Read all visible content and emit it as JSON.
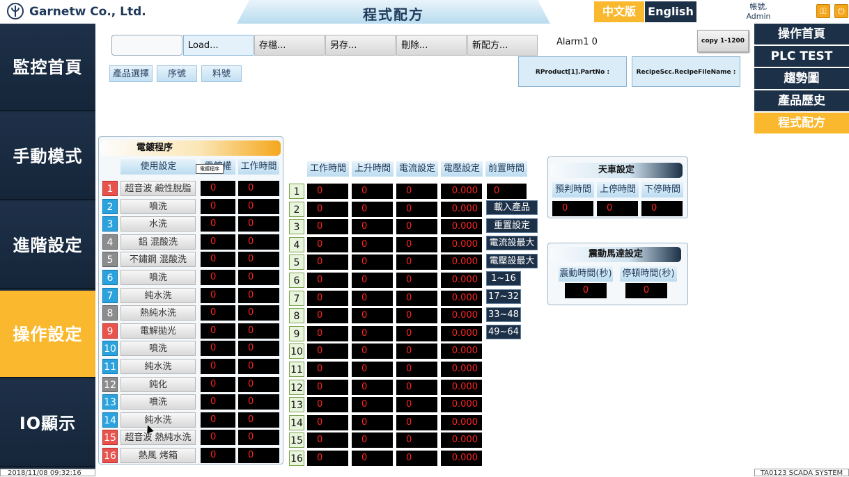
{
  "header": {
    "company": "Garnetw Co., Ltd.",
    "title": "程式配方",
    "lang_zh": "中文版",
    "lang_en": "English",
    "account_label": "帳號,",
    "account_user": "Admin"
  },
  "left_nav": [
    "監控首頁",
    "手動模式",
    "進階設定",
    "操作設定",
    "IO顯示"
  ],
  "right_nav": [
    "操作首頁",
    "PLC TEST",
    "趨勢圖",
    "產品歷史",
    "程式配方"
  ],
  "toolbar": {
    "recipe_input_value": "",
    "load": "Load...",
    "save": "存檔...",
    "save_as": "另存...",
    "delete": "刪除...",
    "new_recipe": "新配方...",
    "alarm": "Alarm1 0",
    "copy": "copy 1-1200"
  },
  "selectors": [
    "產品選擇",
    "序號",
    "料號"
  ],
  "info_boxes": {
    "part_no": "RProduct[1].PartNo :",
    "recipe_file": "RecipeScc.RecipeFileName :"
  },
  "process_panel": {
    "title": "電鍍程序",
    "col_use": "使用設定",
    "col_auth": "電鍍權",
    "col_work": "工作時間",
    "tooltip": "電鍍程序",
    "rows": [
      {
        "n": "1",
        "name": "超音波 鹼性脫脂",
        "a": "0",
        "b": "0"
      },
      {
        "n": "2",
        "name": "噴洗",
        "a": "0",
        "b": "0"
      },
      {
        "n": "3",
        "name": "水洗",
        "a": "0",
        "b": "0"
      },
      {
        "n": "4",
        "name": "鋁 混酸洗",
        "a": "0",
        "b": "0"
      },
      {
        "n": "5",
        "name": "不鏽鋼 混酸洗",
        "a": "0",
        "b": "0"
      },
      {
        "n": "6",
        "name": "噴洗",
        "a": "0",
        "b": "0"
      },
      {
        "n": "7",
        "name": "純水洗",
        "a": "0",
        "b": "0"
      },
      {
        "n": "8",
        "name": "熱純水洗",
        "a": "0",
        "b": "0"
      },
      {
        "n": "9",
        "name": "電解拋光",
        "a": "0",
        "b": "0"
      },
      {
        "n": "10",
        "name": "噴洗",
        "a": "0",
        "b": "0"
      },
      {
        "n": "11",
        "name": "純水洗",
        "a": "0",
        "b": "0"
      },
      {
        "n": "12",
        "name": "鈍化",
        "a": "0",
        "b": "0"
      },
      {
        "n": "13",
        "name": "噴洗",
        "a": "0",
        "b": "0"
      },
      {
        "n": "14",
        "name": "純水洗",
        "a": "0",
        "b": "0"
      },
      {
        "n": "15",
        "name": "超音波 熱純水洗",
        "a": "0",
        "b": "0"
      },
      {
        "n": "16",
        "name": "熱風 烤箱",
        "a": "0",
        "b": "0"
      }
    ]
  },
  "settings_table": {
    "headers": [
      "工作時間",
      "上升時間",
      "電流設定",
      "電壓設定",
      "前置時間"
    ],
    "rows": [
      {
        "n": "1",
        "v": [
          "0",
          "0",
          "0",
          "0.000"
        ]
      },
      {
        "n": "2",
        "v": [
          "0",
          "0",
          "0",
          "0.000"
        ]
      },
      {
        "n": "3",
        "v": [
          "0",
          "0",
          "0",
          "0.000"
        ]
      },
      {
        "n": "4",
        "v": [
          "0",
          "0",
          "0",
          "0.000"
        ]
      },
      {
        "n": "5",
        "v": [
          "0",
          "0",
          "0",
          "0.000"
        ]
      },
      {
        "n": "6",
        "v": [
          "0",
          "0",
          "0",
          "0.000"
        ]
      },
      {
        "n": "7",
        "v": [
          "0",
          "0",
          "0",
          "0.000"
        ]
      },
      {
        "n": "8",
        "v": [
          "0",
          "0",
          "0",
          "0.000"
        ]
      },
      {
        "n": "9",
        "v": [
          "0",
          "0",
          "0",
          "0.000"
        ]
      },
      {
        "n": "10",
        "v": [
          "0",
          "0",
          "0",
          "0.000"
        ]
      },
      {
        "n": "11",
        "v": [
          "0",
          "0",
          "0",
          "0.000"
        ]
      },
      {
        "n": "12",
        "v": [
          "0",
          "0",
          "0",
          "0.000"
        ]
      },
      {
        "n": "13",
        "v": [
          "0",
          "0",
          "0",
          "0.000"
        ]
      },
      {
        "n": "14",
        "v": [
          "0",
          "0",
          "0",
          "0.000"
        ]
      },
      {
        "n": "15",
        "v": [
          "0",
          "0",
          "0",
          "0.000"
        ]
      },
      {
        "n": "16",
        "v": [
          "0",
          "0",
          "0",
          "0.000"
        ]
      }
    ],
    "pre_time_value": "0",
    "side_buttons": [
      "載入產品",
      "重置設定",
      "電流設最大",
      "電壓設最大",
      "1~16",
      "17~32",
      "33~48",
      "49~64"
    ]
  },
  "crane_panel": {
    "title": "天車設定",
    "headers": [
      "預判時間",
      "上停時間",
      "下停時間"
    ],
    "values": [
      "0",
      "0",
      "0"
    ]
  },
  "vibration_panel": {
    "title": "震動馬達設定",
    "headers": [
      "震動時間(秒)",
      "停頓時間(秒)"
    ],
    "values": [
      "0",
      "0"
    ]
  },
  "footer": {
    "datetime": "2018/11/08 09:32:16",
    "system": "TA0123 SCADA SYSTEM"
  }
}
